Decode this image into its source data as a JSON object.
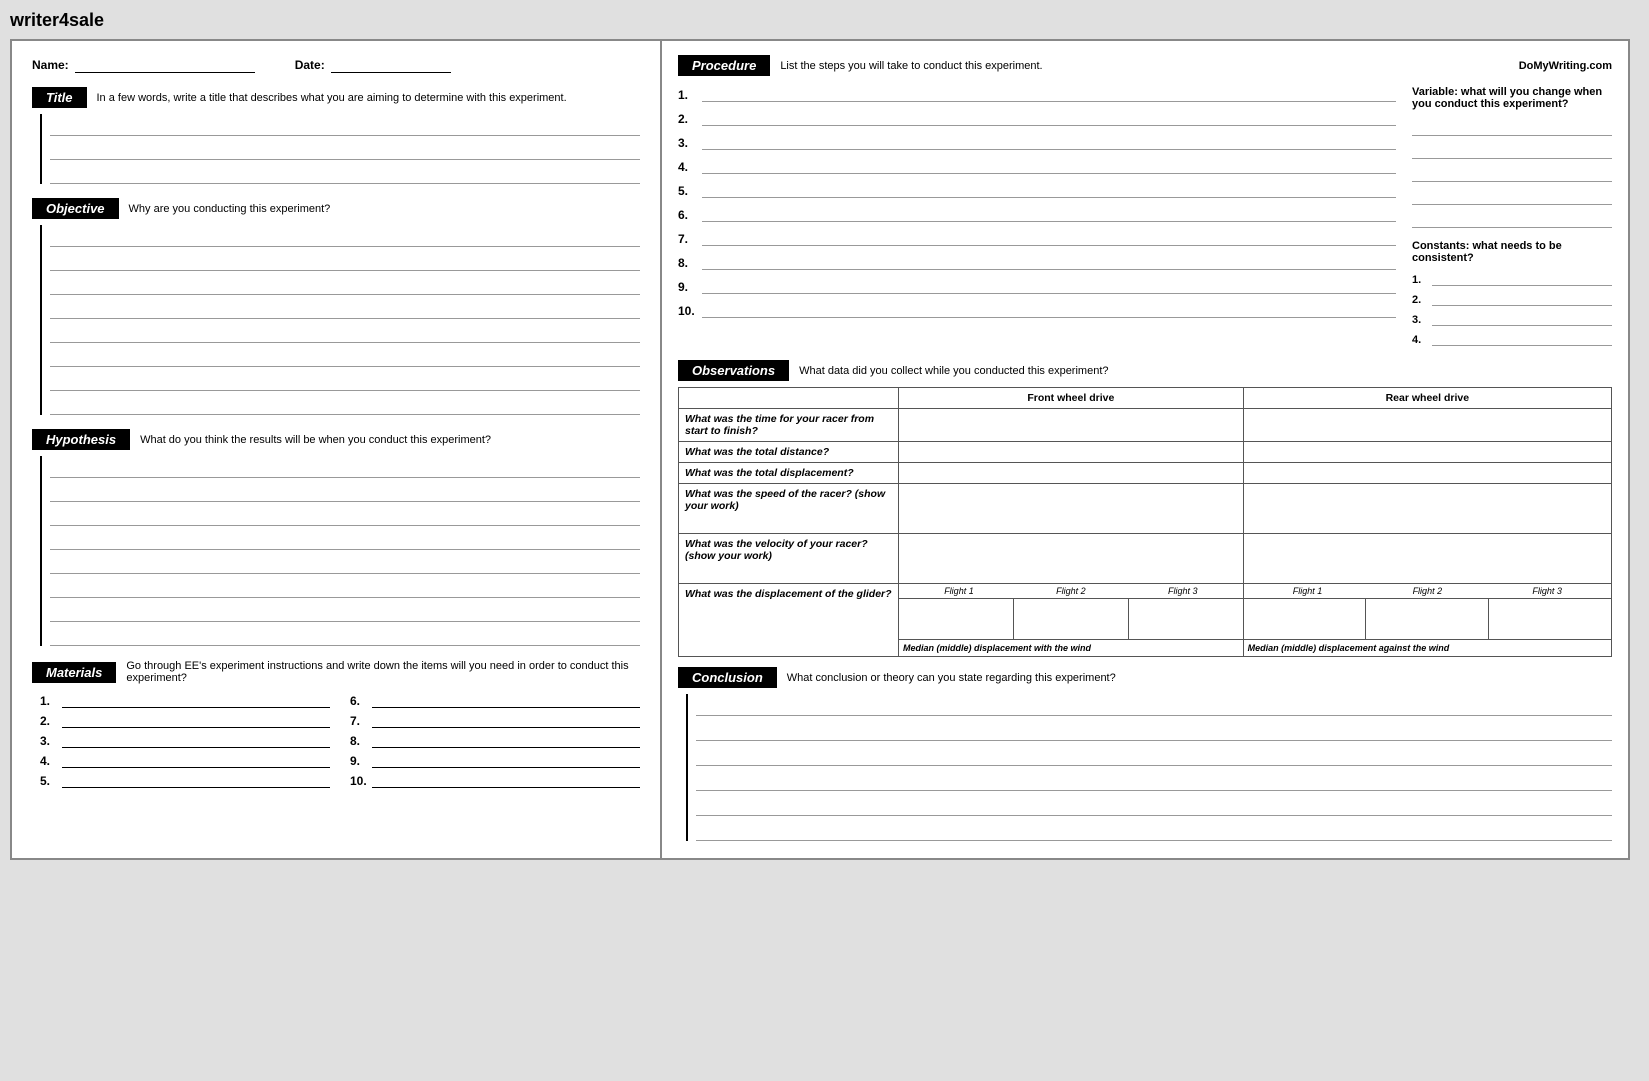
{
  "site": {
    "title": "writer4sale"
  },
  "header": {
    "name_label": "Name:",
    "date_label": "Date:"
  },
  "left": {
    "title_label": "Title",
    "title_hint": "In a few words, write a title that describes what you are aiming to determine with this experiment.",
    "objective_label": "Objective",
    "objective_hint": "Why are you conducting this experiment?",
    "hypothesis_label": "Hypothesis",
    "hypothesis_hint": "What do you think the results will be when you conduct this experiment?",
    "materials_label": "Materials",
    "materials_hint": "Go through EE's experiment instructions and write down the items will you need in order to conduct this experiment?",
    "materials_items": [
      {
        "num": "1.",
        "col": 1
      },
      {
        "num": "2.",
        "col": 1
      },
      {
        "num": "3.",
        "col": 1
      },
      {
        "num": "4.",
        "col": 1
      },
      {
        "num": "5.",
        "col": 1
      },
      {
        "num": "6.",
        "col": 2
      },
      {
        "num": "7.",
        "col": 2
      },
      {
        "num": "8.",
        "col": 2
      },
      {
        "num": "9.",
        "col": 2
      },
      {
        "num": "10.",
        "col": 2
      }
    ]
  },
  "right": {
    "procedure_label": "Procedure",
    "procedure_hint": "List the steps you will take to conduct this experiment.",
    "domywriting": "DoMyWriting.com",
    "steps": [
      {
        "num": "1."
      },
      {
        "num": "2."
      },
      {
        "num": "3."
      },
      {
        "num": "4."
      },
      {
        "num": "5."
      },
      {
        "num": "6."
      },
      {
        "num": "7."
      },
      {
        "num": "8."
      },
      {
        "num": "9."
      },
      {
        "num": "10."
      }
    ],
    "variable_title": "Variable: what will you change when you conduct this experiment?",
    "constants_title": "Constants: what needs to be consistent?",
    "constants_items": [
      {
        "num": "1."
      },
      {
        "num": "2."
      },
      {
        "num": "3."
      },
      {
        "num": "4."
      }
    ],
    "observations_label": "Observations",
    "observations_hint": "What data did you collect while you conducted this experiment?",
    "obs_col1": "Front wheel drive",
    "obs_col2": "Rear wheel drive",
    "obs_rows": [
      {
        "question": "What was the time for your racer from start to finish?",
        "type": "simple"
      },
      {
        "question": "What was the total distance?",
        "type": "simple"
      },
      {
        "question": "What was the total displacement?",
        "type": "simple"
      },
      {
        "question": "What was the speed of the racer? (show your work)",
        "type": "simple"
      },
      {
        "question": "What was the velocity of your racer? (show your work)",
        "type": "simple"
      }
    ],
    "flight_labels": [
      "Flight 1",
      "Flight 2",
      "Flight 3"
    ],
    "glider_question": "What was the displacement of the glider?",
    "glider_median1": "Median (middle) displacement with the wind",
    "glider_median2": "Median (middle) displacement against the wind",
    "conclusion_label": "Conclusion",
    "conclusion_hint": "What conclusion or theory can you state regarding this experiment?"
  }
}
